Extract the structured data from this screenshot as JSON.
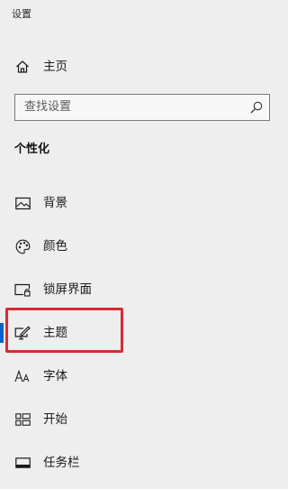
{
  "window": {
    "title": "设置"
  },
  "home": {
    "label": "主页",
    "icon": "home-icon"
  },
  "search": {
    "placeholder": "查找设置",
    "value": "",
    "icon": "search-icon"
  },
  "section": {
    "heading": "个性化"
  },
  "nav": {
    "items": [
      {
        "label": "背景",
        "icon": "picture-icon",
        "selected": false
      },
      {
        "label": "颜色",
        "icon": "palette-icon",
        "selected": false
      },
      {
        "label": "锁屏界面",
        "icon": "lock-screen-icon",
        "selected": false
      },
      {
        "label": "主题",
        "icon": "theme-brush-icon",
        "selected": true
      },
      {
        "label": "字体",
        "icon": "font-icon",
        "selected": false
      },
      {
        "label": "开始",
        "icon": "start-icon",
        "selected": false
      },
      {
        "label": "任务栏",
        "icon": "taskbar-icon",
        "selected": false
      }
    ]
  },
  "colors": {
    "accent": "#0a64c8",
    "highlight_annotation": "#d72b33",
    "background": "#eeeeee"
  }
}
